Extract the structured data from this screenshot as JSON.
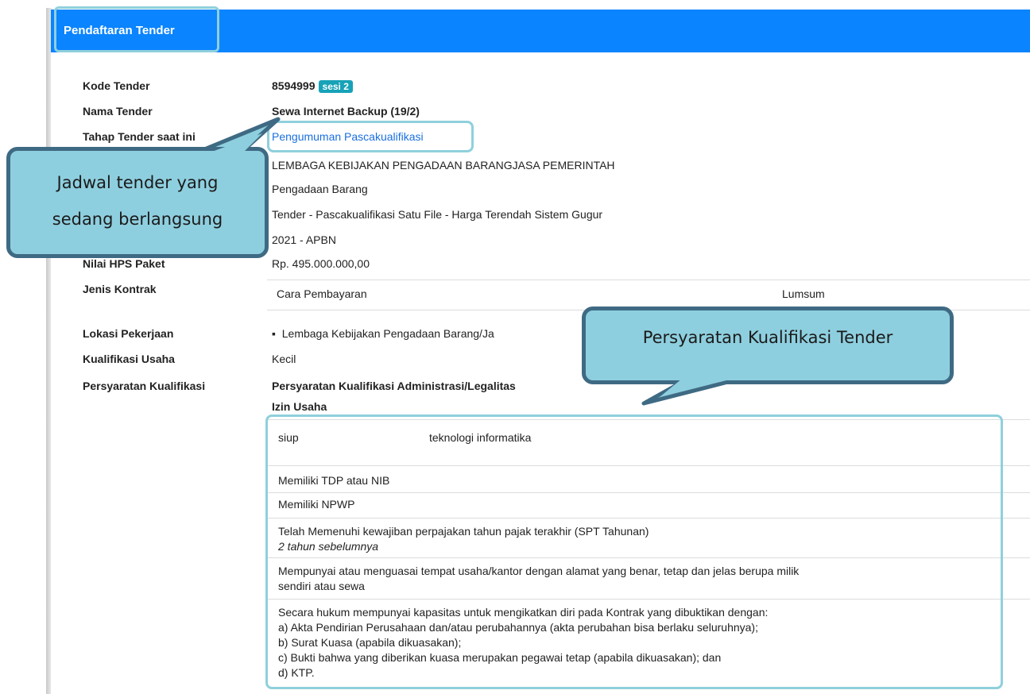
{
  "header": {
    "title": "Pendaftaran Tender"
  },
  "details": [
    {
      "label": "Kode Tender",
      "value": "8594999",
      "badge": "sesi 2"
    },
    {
      "label": "Nama Tender",
      "value": "Sewa Internet Backup (19/2)"
    },
    {
      "label": "Tahap Tender saat ini",
      "value": "Pengumuman Pascakualifikasi"
    },
    {
      "label": "",
      "value": "LEMBAGA KEBIJAKAN PENGADAAN BARANGJASA PEMERINTAH"
    },
    {
      "label": "",
      "value": "Pengadaan Barang"
    },
    {
      "label": "",
      "value": "Tender - Pascakualifikasi Satu File - Harga Terendah Sistem Gugur"
    },
    {
      "label": "",
      "value": "2021 - APBN"
    },
    {
      "label": "Nilai HPS Paket",
      "value": "Rp. 495.000.000,00"
    },
    {
      "label": "Jenis Kontrak",
      "value": "Cara Pembayaran",
      "value2": "Lumsum"
    },
    {
      "label": "Lokasi Pekerjaan",
      "value": "Lembaga Kebijakan Pengadaan Barang/Ja"
    },
    {
      "label": "Kualifikasi Usaha",
      "value": "Kecil"
    },
    {
      "label": "Persyaratan Kualifikasi",
      "value": "Persyaratan Kualifikasi Administrasi/Legalitas"
    }
  ],
  "requirements": {
    "izin_title": "Izin Usaha",
    "izin": {
      "jenis": "siup",
      "klasifikasi": "teknologi informatika"
    },
    "items": [
      {
        "lines": [
          "Memiliki TDP atau NIB"
        ]
      },
      {
        "lines": [
          "Memiliki NPWP"
        ]
      },
      {
        "lines": [
          "Telah Memenuhi kewajiban perpajakan tahun pajak terakhir (SPT Tahunan)"
        ],
        "note": "2 tahun sebelumnya"
      },
      {
        "lines": [
          "Mempunyai atau menguasai tempat usaha/kantor dengan alamat yang benar, tetap dan jelas berupa milik",
          "sendiri atau sewa"
        ]
      },
      {
        "lines": [
          "Secara hukum mempunyai kapasitas untuk mengikatkan diri pada Kontrak yang dibuktikan dengan:",
          "a) Akta Pendirian Perusahaan dan/atau perubahannya (akta perubahan bisa berlaku seluruhnya);",
          "b) Surat Kuasa (apabila dikuasakan);",
          "c) Bukti bahwa yang diberikan kuasa merupakan pegawai tetap (apabila dikuasakan); dan",
          "d) KTP."
        ]
      }
    ]
  },
  "callouts": {
    "jadwal": [
      "Jadwal tender yang",
      "sedang berlangsung"
    ],
    "persyaratan": "Persyaratan Kualifikasi Tender"
  },
  "colors": {
    "header": "#0a84ff",
    "highlight": "#8fd0dc",
    "callout_fill": "#8ecfdf",
    "callout_border": "#3f6a83",
    "link": "#1a6fe0",
    "badge": "#17a2b8"
  }
}
